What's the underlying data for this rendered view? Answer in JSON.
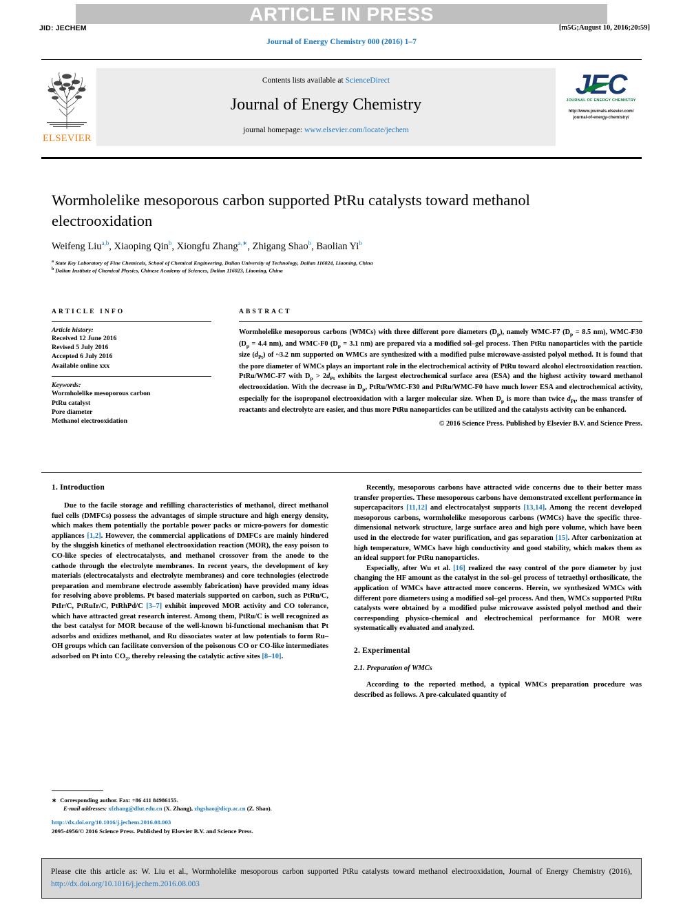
{
  "header": {
    "watermark": "ARTICLE IN PRESS",
    "jid": "JID: JECHEM",
    "stamp": "[m5G;August 10, 2016;20:59]",
    "running_head": "Journal of Energy Chemistry 000 (2016) 1–7"
  },
  "masthead": {
    "publisher": "ELSEVIER",
    "contents_prefix": "Contents lists available at ",
    "contents_link": "ScienceDirect",
    "journal_title": "Journal of Energy Chemistry",
    "homepage_prefix": "journal homepage: ",
    "homepage_link": "www.elsevier.com/locate/jechem",
    "logo_text": "JEC",
    "logo_subtitle": "JOURNAL OF ENERGY CHEMISTRY",
    "logo_url_line1": "http://www.journals.elsevier.com/",
    "logo_url_line2": "journal-of-energy-chemistry/"
  },
  "article": {
    "title": "Wormholelike mesoporous carbon supported PtRu catalysts toward methanol electrooxidation",
    "authors_html": "Weifeng Liu<sup>a,b</sup>, Xiaoping Qin<sup>b</sup>, Xiongfu Zhang<sup>a,∗</sup>, Zhigang Shao<sup>b</sup>, Baolian Yi<sup>b</sup>",
    "affiliation_a": "State Key Laboratory of Fine Chemicals, School of Chemical Engineering, Dalian University of Technology, Dalian 116024, Liaoning, China",
    "affiliation_b": "Dalian Institute of Chemical Physics, Chinese Academy of Sciences, Dalian 116023, Liaoning, China"
  },
  "article_info": {
    "heading": "ARTICLE INFO",
    "history_label": "Article history:",
    "history": [
      "Received 12 June 2016",
      "Revised 5 July 2016",
      "Accepted 6 July 2016",
      "Available online xxx"
    ],
    "keywords_label": "Keywords:",
    "keywords": [
      "Wormholelike mesoporous carbon",
      "PtRu catalyst",
      "Pore diameter",
      "Methanol electrooxidation"
    ]
  },
  "abstract": {
    "heading": "ABSTRACT",
    "text_html": "Wormholelike mesoporous carbons (WMCs) with three different pore diameters (D<sub>p</sub>), namely WMC-F7 (D<sub>p</sub> = 8.5 nm), WMC-F30 (D<sub>p</sub> = 4.4 nm), and WMC-F0 (D<sub>p</sub> = 3.1 nm) are prepared via a modified sol–gel process. Then PtRu nanoparticles with the particle size (<i>d</i><sub>Pt</sub>) of ~3.2 nm supported on WMCs are synthesized with a modified pulse microwave-assisted polyol method. It is found that the pore diameter of WMCs plays an important role in the electrochemical activity of PtRu toward alcohol electrooxidation reaction. PtRu/WMC-F7 with D<sub>p</sub> &gt; 2<i>d</i><sub>Pt</sub> exhibits the largest electrochemical surface area (ESA) and the highest activity toward methanol electrooxidation. With the decrease in D<sub>p</sub>, PtRu/WMC-F30 and PtRu/WMC-F0 have much lower ESA and electrochemical activity, especially for the isopropanol electrooxidation with a larger molecular size. When D<sub>p</sub> is more than twice <i>d</i><sub>Pt</sub>, the mass transfer of reactants and electrolyte are easier, and thus more PtRu nanoparticles can be utilized and the catalysts activity can be enhanced.",
    "copyright": "© 2016 Science Press. Published by Elsevier B.V. and Science Press."
  },
  "body": {
    "intro_heading": "1. Introduction",
    "intro_p1_html": "Due to the facile storage and refilling characteristics of methanol, direct methanol fuel cells (DMFCs) possess the advantages of simple structure and high energy density, which makes them potentially the portable power packs or micro-powers for domestic appliances <span class=\"ref\">[1,2]</span>. However, the commercial applications of DMFCs are mainly hindered by the sluggish kinetics of methanol electrooxidation reaction (MOR), the easy poison to CO-like species of electrocatalysts, and methanol crossover from the anode to the cathode through the electrolyte membranes. In recent years, the development of key materials (electrocatalysts and electrolyte membranes) and core technologies (electrode preparation and membrane electrode assembly fabrication) have provided many ideas for resolving above problems. Pt based materials supported on carbon, such as PtRu/C, PtIr/C, PtRuIr/C, PtRhPd/C <span class=\"ref\">[3–7]</span> exhibit improved MOR activity and CO tolerance, which have attracted great research interest. Among them, PtRu/C is well recognized as the best catalyst for MOR because of the well-known bi-functional mechanism that Pt adsorbs and oxidizes methanol, and Ru dissociates water at low potentials to form Ru–OH groups which can facilitate conversion of the poisonous CO or CO-like intermediates adsorbed on Pt into CO<sub>2</sub>, thereby releasing the catalytic active sites <span class=\"ref\">[8–10]</span>.",
    "right_p1_html": "Recently, mesoporous carbons have attracted wide concerns due to their better mass transfer properties. These mesoporous carbons have demonstrated excellent performance in supercapacitors <span class=\"ref\">[11,12]</span> and electrocatalyst supports <span class=\"ref\">[13,14]</span>. Among the recent developed mesoporous carbons, wormholelike mesoporous carbons (WMCs) have the specific three-dimensional network structure, large surface area and high pore volume, which have been used in the electrode for water purification, and gas separation <span class=\"ref\">[15]</span>. After carbonization at high temperature, WMCs have high conductivity and good stability, which makes them as an ideal support for PtRu nanoparticles.",
    "right_p2_html": "Especially, after Wu et al. <span class=\"ref\">[16]</span> realized the easy control of the pore diameter by just changing the HF amount as the catalyst in the sol–gel process of tetraethyl orthosilicate, the application of WMCs have attracted more concerns. Herein, we synthesized WMCs with different pore diameters using a modified sol–gel process. And then, WMCs supported PtRu catalysts were obtained by a modified pulse microwave assisted polyol method and their corresponding physico-chemical and electrochemical performance for MOR were systematically evaluated and analyzed.",
    "exp_heading": "2. Experimental",
    "exp_subheading": "2.1. Preparation of WMCs",
    "exp_p1_html": "According to the reported method, a typical WMCs preparation procedure was described as follows. A pre-calculated quantity of"
  },
  "footnotes": {
    "corresponding_star": "∗",
    "corresponding_text": "Corresponding author. Fax: +86 411 84986155.",
    "email_label": "E-mail addresses:",
    "email1": "xfzhang@dlut.edu.cn",
    "email1_who": "(X. Zhang),",
    "email2": "zhgshao@dicp.ac.cn",
    "email2_who": "(Z. Shao).",
    "doi_url": "http://dx.doi.org/10.1016/j.jechem.2016.08.003",
    "issn_line": "2095-4956/© 2016 Science Press. Published by Elsevier B.V. and Science Press."
  },
  "cite_box": {
    "prefix": "Please cite this article as: W. Liu et al., Wormholelike mesoporous carbon supported PtRu catalysts toward methanol electrooxidation, Journal of Energy Chemistry (2016), ",
    "link": "http://dx.doi.org/10.1016/j.jechem.2016.08.003"
  },
  "colors": {
    "link": "#1c75bc",
    "watermark_band": "#bfbfbf",
    "masthead_bg": "#ececec",
    "cite_bg": "#d7d7d7",
    "elsevier_orange": "#ef7d10",
    "jec_navy": "#1b3a72",
    "jec_green": "#0b7a3b"
  }
}
